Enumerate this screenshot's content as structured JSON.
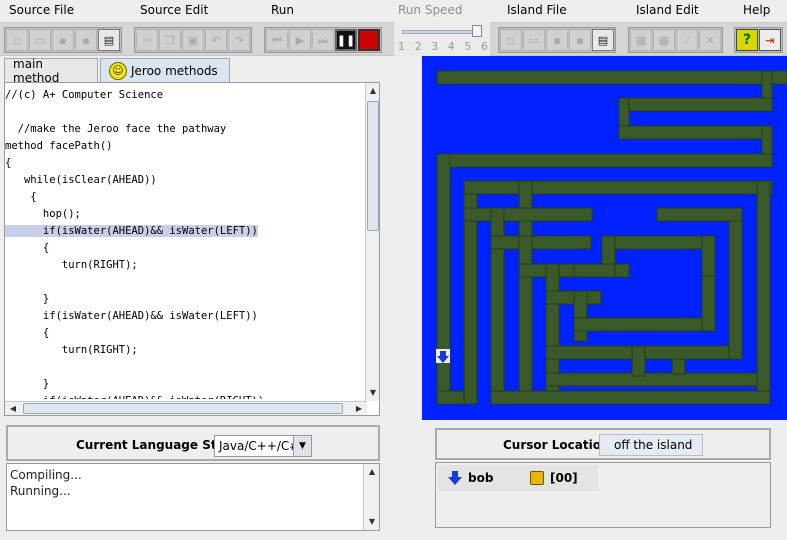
{
  "menu": [
    {
      "label": "Source File",
      "enabled": true
    },
    {
      "label": "Source Edit",
      "enabled": true
    },
    {
      "label": "Run",
      "enabled": true
    },
    {
      "label": "Run Speed",
      "enabled": false
    },
    {
      "label": "Island File",
      "enabled": true
    },
    {
      "label": "Island Edit",
      "enabled": true
    },
    {
      "label": "Help",
      "enabled": true
    }
  ],
  "speed": {
    "labels": [
      "1",
      "2",
      "3",
      "4",
      "5",
      "6"
    ],
    "value": 6
  },
  "tabs": {
    "main": "main method",
    "methods": "Jeroo methods"
  },
  "code": {
    "lines": [
      "//(c) A+ Computer Science",
      "",
      "  //make the Jeroo face the pathway",
      "method facePath()",
      "{",
      "   while(isClear(AHEAD))",
      "    {",
      "      hop();",
      "      if(isWater(AHEAD)&& isWater(LEFT))",
      "      {",
      "         turn(RIGHT);",
      "",
      "      }",
      "      if(isWater(AHEAD)&& isWater(LEFT))",
      "      {",
      "         turn(RIGHT);",
      "",
      "      }",
      "      if(isWater(AHEAD)&& isWater(RIGHT))"
    ],
    "highlighted_line": 8
  },
  "language": {
    "label": "Current Language Style",
    "value": "Java/C++/C#"
  },
  "console": {
    "lines": [
      "Compiling...",
      "Running..."
    ]
  },
  "cursor": {
    "label": "Cursor Location",
    "value": "off the island"
  },
  "status": {
    "jeroo_name": "bob",
    "flowers": "[00]"
  },
  "colors": {
    "water": "#0022ff",
    "land": "#3a5a2a",
    "highlight": "#c9cfe8"
  },
  "icons": [
    "new-file-icon",
    "open-icon",
    "save-icon",
    "save-as-icon",
    "print-icon",
    "cut-icon",
    "copy-icon",
    "paste-icon",
    "undo-icon",
    "redo-icon",
    "reset-icon",
    "step-icon",
    "run-icon",
    "pause-icon",
    "stop-icon",
    "island-new-icon",
    "island-open-icon",
    "island-save-icon",
    "island-save-as-icon",
    "island-print-icon",
    "island-clear-icon",
    "grid-icon",
    "wand-icon",
    "close-icon",
    "help-icon",
    "exit-icon",
    "smiley-icon",
    "jeroo-arrow-icon",
    "flower-icon"
  ]
}
